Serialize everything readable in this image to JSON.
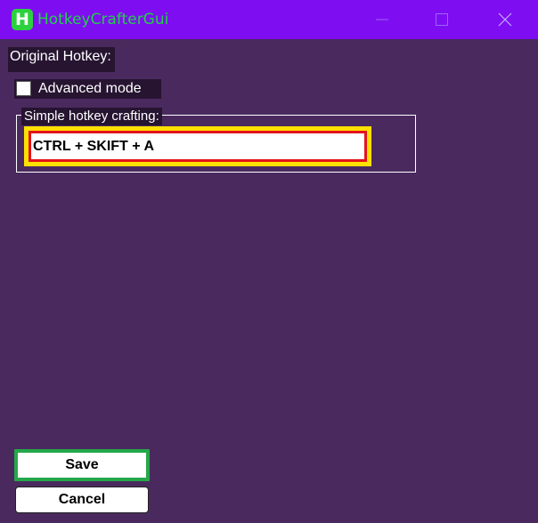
{
  "window": {
    "title": "HotkeyCrafterGui",
    "icon_letter": "H",
    "titlebar_color": "#7f0df2",
    "background_color": "#4a2a5e",
    "controls": [
      "minimize-icon",
      "maximize-icon",
      "close-icon"
    ]
  },
  "labels": {
    "original_hotkey": "Original Hotkey:"
  },
  "advanced_mode": {
    "label": "Advanced mode",
    "checked": false
  },
  "simple_group": {
    "legend": "Simple hotkey crafting:",
    "hotkey_value": "CTRL + SKIFT + A",
    "highlight_colors": [
      "#ffe000",
      "#e4121d"
    ]
  },
  "buttons": {
    "save_label": "Save",
    "save_border_color": "#26a84a",
    "cancel_label": "Cancel"
  }
}
